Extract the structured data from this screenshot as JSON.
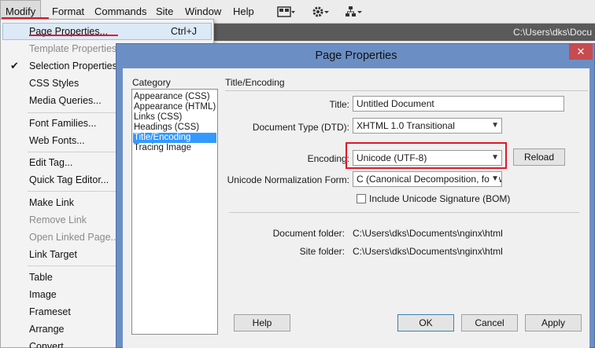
{
  "menubar": {
    "items": [
      "Modify",
      "Format",
      "Commands",
      "Site",
      "Window",
      "Help"
    ]
  },
  "icons": [
    "layout-icon",
    "gear-icon",
    "site-icon"
  ],
  "background_panel": {
    "path": "C:\\Users\\dks\\Docu"
  },
  "dropdown": {
    "items": [
      {
        "label": "Page Properties...",
        "shortcut": "Ctrl+J"
      },
      {
        "label": "Template Properties..."
      },
      {
        "label": "Selection Properties"
      },
      {
        "label": "CSS Styles"
      },
      {
        "label": "Media Queries..."
      },
      {
        "label": "Font Families..."
      },
      {
        "label": "Web Fonts..."
      },
      {
        "label": "Edit Tag..."
      },
      {
        "label": "Quick Tag Editor..."
      },
      {
        "label": "Make Link"
      },
      {
        "label": "Remove Link"
      },
      {
        "label": "Open Linked Page..."
      },
      {
        "label": "Link Target"
      },
      {
        "label": "Table"
      },
      {
        "label": "Image"
      },
      {
        "label": "Frameset"
      },
      {
        "label": "Arrange"
      },
      {
        "label": "Convert"
      }
    ]
  },
  "dialog": {
    "title": "Page Properties",
    "close": "✕",
    "category_label": "Category",
    "categories": [
      "Appearance (CSS)",
      "Appearance (HTML)",
      "Links (CSS)",
      "Headings (CSS)",
      "Title/Encoding",
      "Tracing Image"
    ],
    "section_title": "Title/Encoding",
    "title_label": "Title:",
    "title_value": "Untitled Document",
    "doctype_label": "Document Type (DTD):",
    "doctype_value": "XHTML 1.0 Transitional",
    "encoding_label": "Encoding:",
    "encoding_value": "Unicode (UTF-8)",
    "reload_button": "Reload",
    "normalization_label": "Unicode Normalization Form:",
    "normalization_value": "C (Canonical Decomposition, follow",
    "bom_label": "Include Unicode Signature (BOM)",
    "doc_folder_label": "Document folder:",
    "doc_folder_value": "C:\\Users\\dks\\Documents\\nginx\\html",
    "site_folder_label": "Site folder:",
    "site_folder_value": "C:\\Users\\dks\\Documents\\nginx\\html",
    "help_button": "Help",
    "ok_button": "OK",
    "cancel_button": "Cancel",
    "apply_button": "Apply"
  }
}
